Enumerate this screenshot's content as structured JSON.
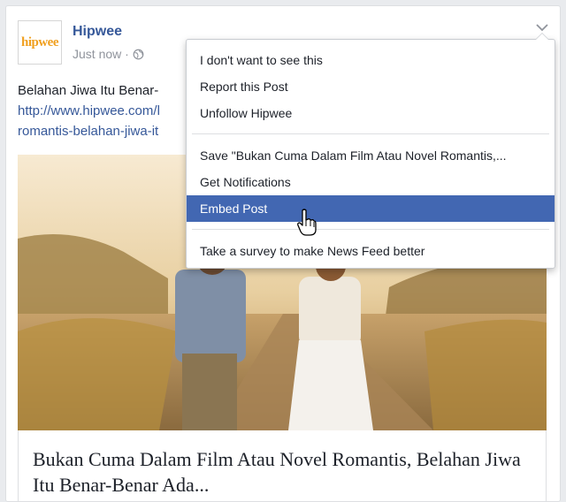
{
  "post": {
    "page_name": "Hipwee",
    "avatar_text": "hipwee",
    "timestamp": "Just now ·",
    "text_line1": "Belahan Jiwa Itu Benar-",
    "link_line1": "http://www.hipwee.com/l",
    "link_line2": "romantis-belahan-jiwa-it",
    "caption_title": "Bukan Cuma Dalam Film Atau Novel Romantis, Belahan Jiwa Itu Benar-Benar Ada..."
  },
  "menu": {
    "items": [
      {
        "label": "I don't want to see this"
      },
      {
        "label": "Report this Post"
      },
      {
        "label": "Unfollow Hipwee"
      },
      {
        "label": "Save \"Bukan Cuma Dalam Film Atau Novel Romantis,..."
      },
      {
        "label": "Get Notifications"
      },
      {
        "label": "Embed Post"
      },
      {
        "label": "Take a survey to make News Feed better"
      }
    ],
    "active_item": "Embed Post"
  },
  "colors": {
    "link": "#365899",
    "highlight": "#4267b2",
    "meta": "#90949c",
    "avatar": "#f0a020"
  },
  "icons": [
    "globe-icon",
    "chevron-down-icon",
    "hand-cursor-icon"
  ]
}
